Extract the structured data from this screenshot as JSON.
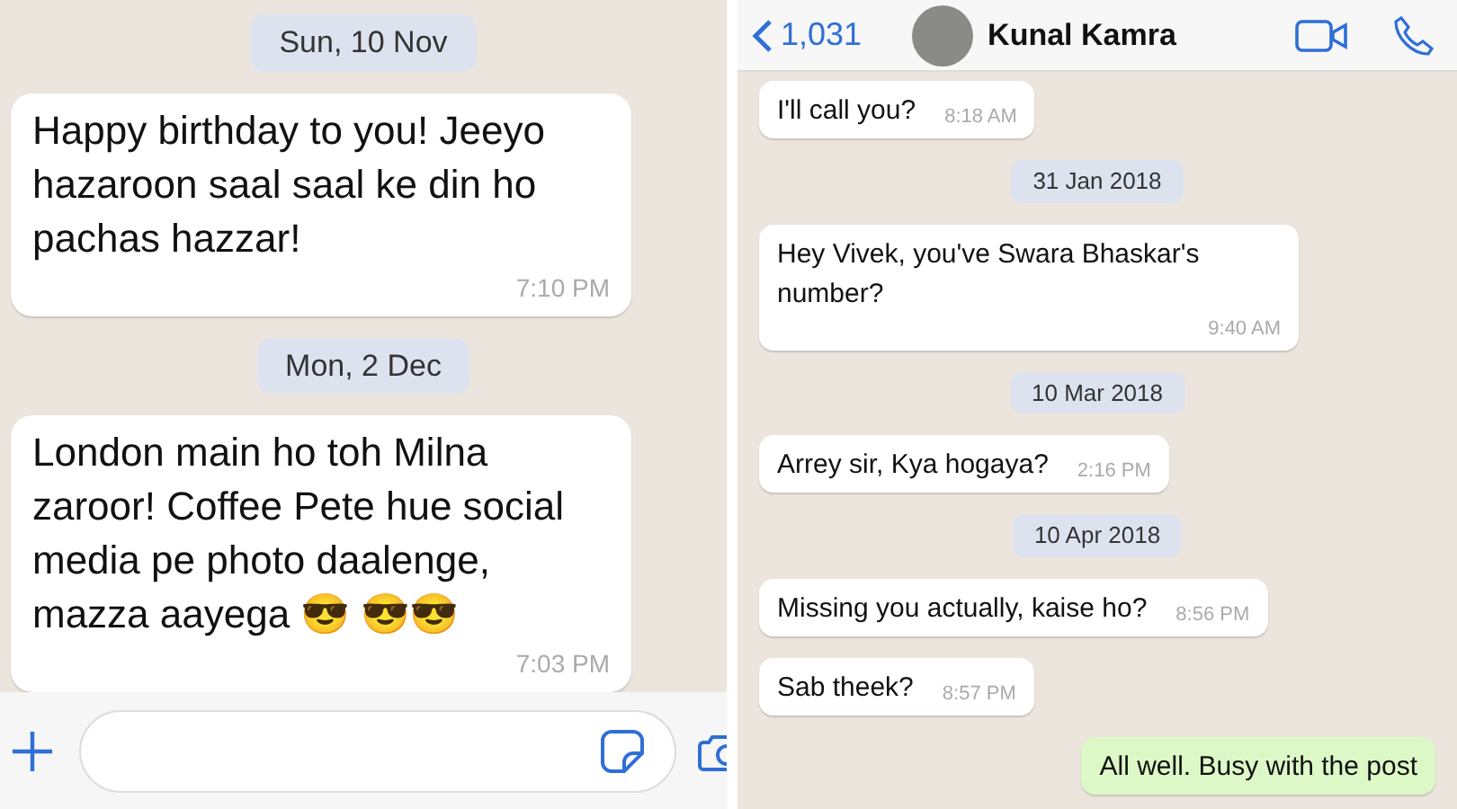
{
  "left_chat": {
    "items": [
      {
        "kind": "date",
        "text": "Sun, 10 Nov"
      },
      {
        "kind": "incoming",
        "text": "Happy birthday to you! Jeeyo hazaroon saal saal ke din ho pachas hazzar!",
        "time": "7:10 PM"
      },
      {
        "kind": "date",
        "text": "Mon, 2 Dec"
      },
      {
        "kind": "incoming",
        "text": "London main ho toh Milna zaroor! Coffee Pete hue social media pe photo daalenge, mazza aayega 😎 😎😎",
        "time": "7:03 PM"
      }
    ]
  },
  "right_chat": {
    "header": {
      "back_count": "1,031",
      "contact_name": "Kunal Kamra"
    },
    "items": [
      {
        "kind": "incoming",
        "text": "I'll call you?",
        "time": "8:18 AM"
      },
      {
        "kind": "date",
        "text": "31 Jan 2018"
      },
      {
        "kind": "incoming",
        "text": "Hey Vivek, you've Swara Bhaskar's number?",
        "time": "9:40 AM"
      },
      {
        "kind": "date",
        "text": "10 Mar 2018"
      },
      {
        "kind": "incoming",
        "text": "Arrey sir, Kya hogaya?",
        "time": "2:16 PM"
      },
      {
        "kind": "date",
        "text": "10 Apr 2018"
      },
      {
        "kind": "incoming",
        "text": "Missing you actually, kaise ho?",
        "time": "8:56 PM"
      },
      {
        "kind": "incoming",
        "text": "Sab theek?",
        "time": "8:57 PM"
      },
      {
        "kind": "outgoing",
        "text": "All well. Busy with the post"
      }
    ]
  }
}
